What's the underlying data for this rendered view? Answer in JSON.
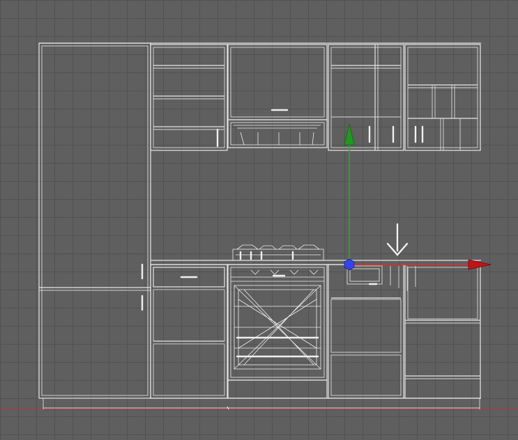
{
  "viewport": {
    "view": "front",
    "background_color": "#5f5f5f",
    "grid_color": "#525252",
    "wire_color": "#e6e6e6",
    "ground_line_color": "#b03a3a"
  },
  "scene": {
    "object": "kitchen-cabinet-set",
    "parts": [
      "tall-pantry-cabinet",
      "upper-cabinets",
      "range-hood",
      "cooktop",
      "oven",
      "sink",
      "base-cabinets",
      "drawers"
    ]
  },
  "gizmo": {
    "type": "move-transform",
    "axes": [
      {
        "name": "y-axis",
        "color": "#22b022"
      },
      {
        "name": "x-axis",
        "color": "#d11a1a"
      }
    ],
    "pivot_color": "#3344ee"
  }
}
